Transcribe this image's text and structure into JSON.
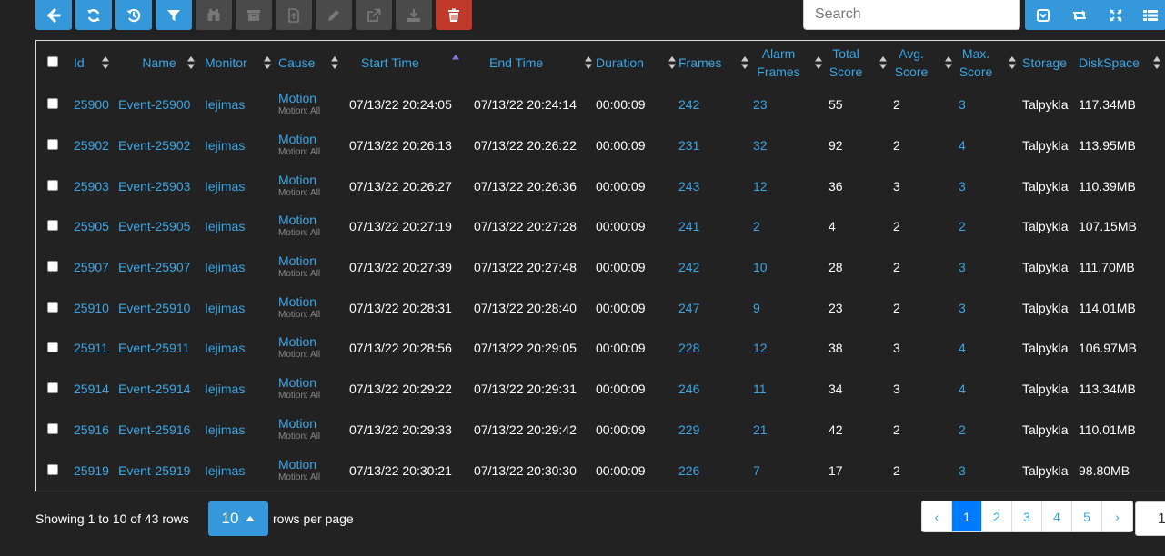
{
  "search": {
    "placeholder": "Search"
  },
  "table": {
    "headers": {
      "id": "Id",
      "name": "Name",
      "monitor": "Monitor",
      "cause": "Cause",
      "start_time": "Start Time",
      "end_time": "End Time",
      "duration": "Duration",
      "frames": "Frames",
      "alarm_frames_1": "Alarm",
      "alarm_frames_2": "Frames",
      "total_score_1": "Total",
      "total_score_2": "Score",
      "avg_score_1": "Avg.",
      "avg_score_2": "Score",
      "max_score_1": "Max.",
      "max_score_2": "Score",
      "storage": "Storage",
      "diskspace": "DiskSpace"
    },
    "rows": [
      {
        "id": "25900",
        "name": "Event-25900",
        "monitor": "Iejimas",
        "cause": "Motion",
        "cause_sub": "Motion: All",
        "start": "07/13/22 20:24:05",
        "end": "07/13/22 20:24:14",
        "duration": "00:00:09",
        "frames": "242",
        "alarm": "23",
        "total": "55",
        "avg": "2",
        "max": "3",
        "storage": "Talpykla",
        "disk": "117.34MB"
      },
      {
        "id": "25902",
        "name": "Event-25902",
        "monitor": "Iejimas",
        "cause": "Motion",
        "cause_sub": "Motion: All",
        "start": "07/13/22 20:26:13",
        "end": "07/13/22 20:26:22",
        "duration": "00:00:09",
        "frames": "231",
        "alarm": "32",
        "total": "92",
        "avg": "2",
        "max": "4",
        "storage": "Talpykla",
        "disk": "113.95MB"
      },
      {
        "id": "25903",
        "name": "Event-25903",
        "monitor": "Iejimas",
        "cause": "Motion",
        "cause_sub": "Motion: All",
        "start": "07/13/22 20:26:27",
        "end": "07/13/22 20:26:36",
        "duration": "00:00:09",
        "frames": "243",
        "alarm": "12",
        "total": "36",
        "avg": "3",
        "max": "3",
        "storage": "Talpykla",
        "disk": "110.39MB"
      },
      {
        "id": "25905",
        "name": "Event-25905",
        "monitor": "Iejimas",
        "cause": "Motion",
        "cause_sub": "Motion: All",
        "start": "07/13/22 20:27:19",
        "end": "07/13/22 20:27:28",
        "duration": "00:00:09",
        "frames": "241",
        "alarm": "2",
        "total": "4",
        "avg": "2",
        "max": "2",
        "storage": "Talpykla",
        "disk": "107.15MB"
      },
      {
        "id": "25907",
        "name": "Event-25907",
        "monitor": "Iejimas",
        "cause": "Motion",
        "cause_sub": "Motion: All",
        "start": "07/13/22 20:27:39",
        "end": "07/13/22 20:27:48",
        "duration": "00:00:09",
        "frames": "242",
        "alarm": "10",
        "total": "28",
        "avg": "2",
        "max": "3",
        "storage": "Talpykla",
        "disk": "111.70MB"
      },
      {
        "id": "25910",
        "name": "Event-25910",
        "monitor": "Iejimas",
        "cause": "Motion",
        "cause_sub": "Motion: All",
        "start": "07/13/22 20:28:31",
        "end": "07/13/22 20:28:40",
        "duration": "00:00:09",
        "frames": "247",
        "alarm": "9",
        "total": "23",
        "avg": "2",
        "max": "3",
        "storage": "Talpykla",
        "disk": "114.01MB"
      },
      {
        "id": "25911",
        "name": "Event-25911",
        "monitor": "Iejimas",
        "cause": "Motion",
        "cause_sub": "Motion: All",
        "start": "07/13/22 20:28:56",
        "end": "07/13/22 20:29:05",
        "duration": "00:00:09",
        "frames": "228",
        "alarm": "12",
        "total": "38",
        "avg": "3",
        "max": "4",
        "storage": "Talpykla",
        "disk": "106.97MB"
      },
      {
        "id": "25914",
        "name": "Event-25914",
        "monitor": "Iejimas",
        "cause": "Motion",
        "cause_sub": "Motion: All",
        "start": "07/13/22 20:29:22",
        "end": "07/13/22 20:29:31",
        "duration": "00:00:09",
        "frames": "246",
        "alarm": "11",
        "total": "34",
        "avg": "3",
        "max": "4",
        "storage": "Talpykla",
        "disk": "113.34MB"
      },
      {
        "id": "25916",
        "name": "Event-25916",
        "monitor": "Iejimas",
        "cause": "Motion",
        "cause_sub": "Motion: All",
        "start": "07/13/22 20:29:33",
        "end": "07/13/22 20:29:42",
        "duration": "00:00:09",
        "frames": "229",
        "alarm": "21",
        "total": "42",
        "avg": "2",
        "max": "2",
        "storage": "Talpykla",
        "disk": "110.01MB"
      },
      {
        "id": "25919",
        "name": "Event-25919",
        "monitor": "Iejimas",
        "cause": "Motion",
        "cause_sub": "Motion: All",
        "start": "07/13/22 20:30:21",
        "end": "07/13/22 20:30:30",
        "duration": "00:00:09",
        "frames": "226",
        "alarm": "7",
        "total": "17",
        "avg": "2",
        "max": "3",
        "storage": "Talpykla",
        "disk": "98.80MB"
      }
    ]
  },
  "footer": {
    "showing": "Showing 1 to 10 of 43 rows",
    "page_size": "10",
    "rows_per_page": "rows per page",
    "pages": [
      "‹",
      "1",
      "2",
      "3",
      "4",
      "5",
      "›"
    ],
    "goto_value": "1"
  },
  "colors": {
    "accent": "#3498db",
    "link": "#3aa6e6",
    "danger": "#c0392b",
    "background": "#222222"
  },
  "icons": {
    "toolbar": [
      "arrow-left-icon",
      "refresh-icon",
      "history-icon",
      "filter-icon",
      "binoculars-icon",
      "archive-icon",
      "file-export-icon",
      "pencil-icon",
      "external-link-icon",
      "download-icon",
      "trash-icon"
    ],
    "right_toolbar": [
      "collapse-icon",
      "toggle-icon",
      "fullscreen-icon",
      "columns-icon"
    ]
  }
}
